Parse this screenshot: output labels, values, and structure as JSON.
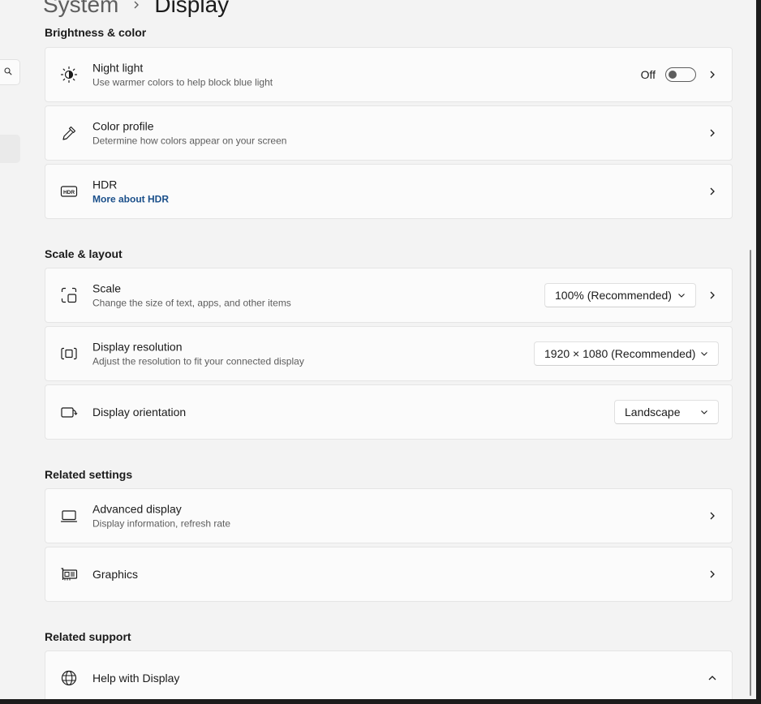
{
  "breadcrumb": {
    "parent": "System",
    "current": "Display"
  },
  "sections": {
    "brightness": "Brightness & color",
    "scale": "Scale & layout",
    "related_settings": "Related settings",
    "related_support": "Related support"
  },
  "night_light": {
    "icon": "night-light-icon",
    "title": "Night light",
    "subtitle": "Use warmer colors to help block blue light",
    "toggle_label": "Off",
    "toggle_on": false
  },
  "color_profile": {
    "icon": "eyedropper-icon",
    "title": "Color profile",
    "subtitle": "Determine how colors appear on your screen"
  },
  "hdr": {
    "icon": "hdr-icon",
    "title": "HDR",
    "link": "More about HDR"
  },
  "scale": {
    "icon": "scale-icon",
    "title": "Scale",
    "subtitle": "Change the size of text, apps, and other items",
    "value": "100% (Recommended)"
  },
  "resolution": {
    "icon": "resolution-icon",
    "title": "Display resolution",
    "subtitle": "Adjust the resolution to fit your connected display",
    "value": "1920 × 1080 (Recommended)"
  },
  "orientation": {
    "icon": "orientation-icon",
    "title": "Display orientation",
    "value": "Landscape"
  },
  "advanced": {
    "icon": "laptop-icon",
    "title": "Advanced display",
    "subtitle": "Display information, refresh rate"
  },
  "graphics": {
    "icon": "graphics-card-icon",
    "title": "Graphics"
  },
  "help": {
    "icon": "globe-icon",
    "title": "Help with Display"
  },
  "colors": {
    "background": "#f3f3f3",
    "card": "#fbfbfb",
    "link": "#1a4f8a",
    "text": "#1b1b1b",
    "secondary_text": "#5d5d5d"
  }
}
